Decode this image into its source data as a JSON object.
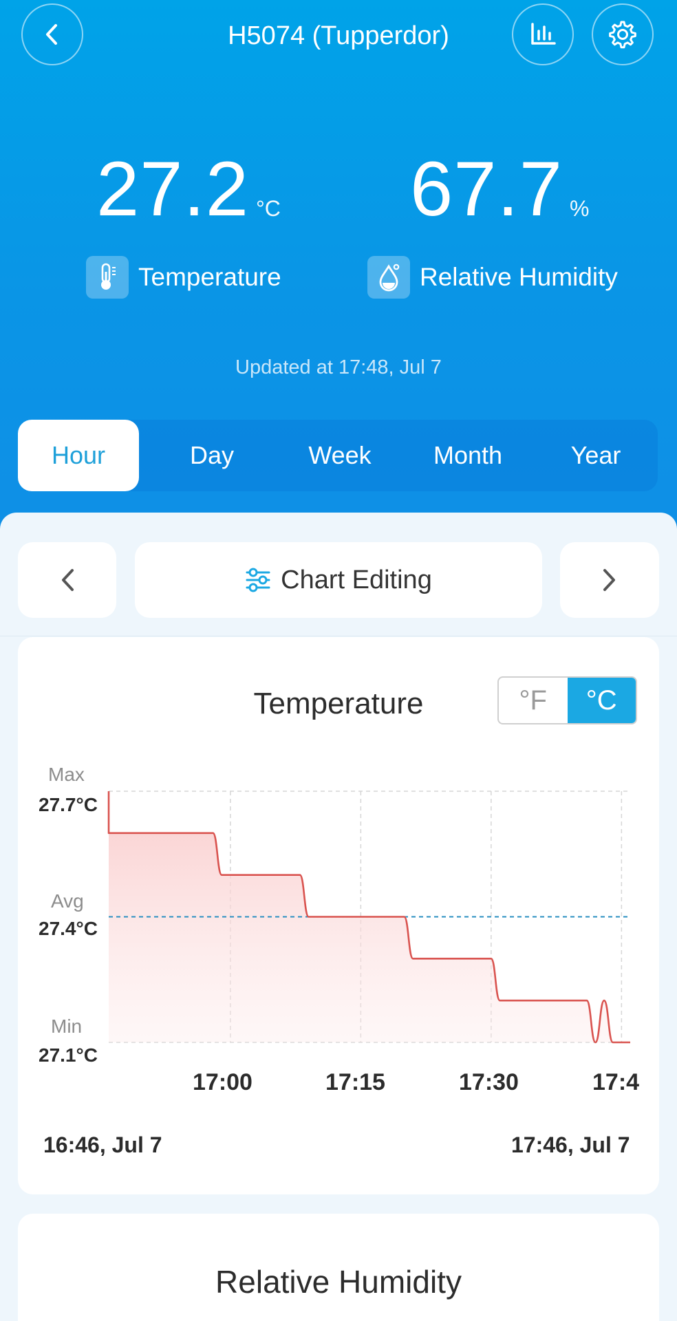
{
  "header": {
    "title": "H5074 (Tupperdor)"
  },
  "readings": {
    "temperature": {
      "value": "27.2",
      "unit": "°C",
      "label": "Temperature"
    },
    "humidity": {
      "value": "67.7",
      "unit": "%",
      "label": "Relative Humidity"
    }
  },
  "updated_text": "Updated at 17:48, Jul 7",
  "periods": [
    {
      "label": "Hour",
      "active": true
    },
    {
      "label": "Day",
      "active": false
    },
    {
      "label": "Week",
      "active": false
    },
    {
      "label": "Month",
      "active": false
    },
    {
      "label": "Year",
      "active": false
    }
  ],
  "chart_nav": {
    "edit_label": "Chart Editing"
  },
  "temperature_chart": {
    "title": "Temperature",
    "units": {
      "f": "°F",
      "c": "°C",
      "selected": "°C"
    },
    "max_label": "Max",
    "max_value": "27.7°C",
    "avg_label": "Avg",
    "avg_value": "27.4°C",
    "min_label": "Min",
    "min_value": "27.1°C",
    "x_ticks": [
      "17:00",
      "17:15",
      "17:30",
      "17:4"
    ],
    "range_start": "16:46, Jul 7",
    "range_end": "17:46, Jul 7"
  },
  "humidity_chart": {
    "title": "Relative Humidity"
  },
  "colors": {
    "header_blue": "#0a95e6",
    "accent": "#1ba8e3",
    "line_red": "#d9534f",
    "avg_line": "#2a8fc1"
  },
  "chart_data": {
    "type": "line",
    "title": "Temperature",
    "xlabel": "",
    "ylabel": "",
    "ylim": [
      27.1,
      27.7
    ],
    "x": [
      "16:46",
      "16:46",
      "16:47",
      "16:58",
      "16:59",
      "17:08",
      "17:09",
      "17:20",
      "17:21",
      "17:30",
      "17:31",
      "17:41",
      "17:42",
      "17:43",
      "17:44",
      "17:46"
    ],
    "series": [
      {
        "values": [
          27.7,
          27.6,
          27.6,
          27.6,
          27.5,
          27.5,
          27.4,
          27.4,
          27.3,
          27.3,
          27.2,
          27.2,
          27.1,
          27.2,
          27.1,
          27.1
        ]
      }
    ],
    "reference_lines": {
      "max": 27.7,
      "avg": 27.4,
      "min": 27.1
    },
    "x_tick_labels": [
      "17:00",
      "17:15",
      "17:30",
      "17:4"
    ],
    "grid": true
  }
}
